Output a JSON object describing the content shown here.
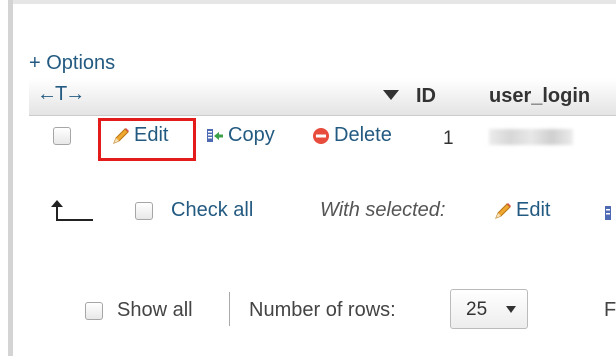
{
  "options": {
    "label": "+ Options"
  },
  "table": {
    "arrows_label": "←T→",
    "columns": {
      "id": "ID",
      "user_login": "user_login"
    },
    "row": {
      "id": "1",
      "actions": {
        "edit": "Edit",
        "copy": "Copy",
        "delete": "Delete"
      }
    }
  },
  "bulk": {
    "check_all": "Check all",
    "with_selected": "With selected:",
    "edit": "Edit"
  },
  "navigation": {
    "show_all": "Show all",
    "rows_label": "Number of rows:",
    "rows_value": "25",
    "trailing": "F"
  },
  "colors": {
    "link": "#235a81",
    "highlight": "#e41b1b",
    "pencil": "#f0a830",
    "delete": "#e74c3c"
  },
  "icons": {
    "edit": "pencil-icon",
    "copy": "copy-icon",
    "delete": "delete-icon",
    "sort": "sort-down-icon",
    "return": "return-arrow-icon"
  }
}
